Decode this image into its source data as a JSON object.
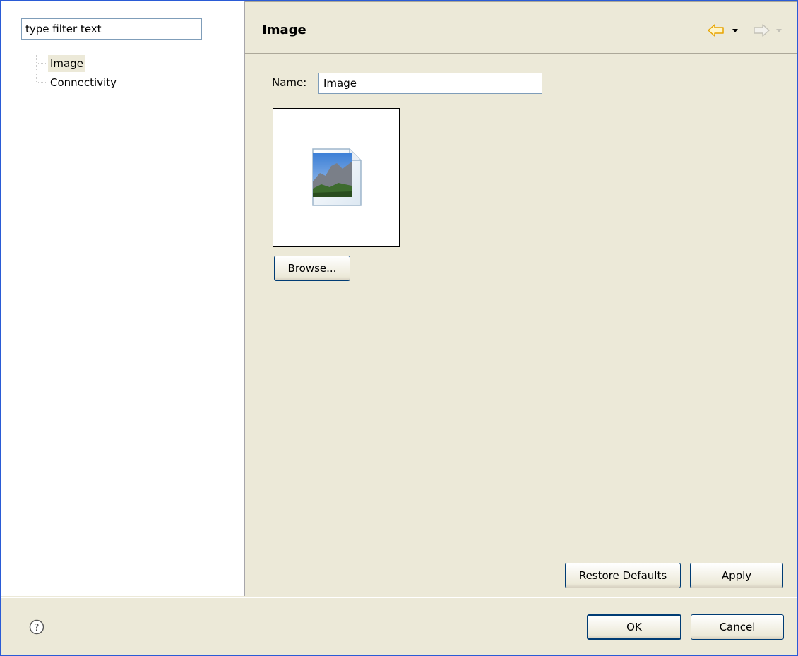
{
  "filter": {
    "placeholder": "type filter text",
    "value": "type filter text"
  },
  "tree": {
    "items": [
      {
        "label": "Image",
        "selected": true
      },
      {
        "label": "Connectivity",
        "selected": false
      }
    ]
  },
  "page": {
    "title": "Image",
    "name_label": "Name:",
    "name_value": "Image",
    "browse_label": "Browse...",
    "restore_defaults_prefix": "Restore ",
    "restore_defaults_mnemonic": "D",
    "restore_defaults_suffix": "efaults",
    "apply_mnemonic": "A",
    "apply_suffix": "pply"
  },
  "navigation": {
    "back_icon": "back-arrow-icon",
    "forward_icon": "forward-arrow-icon",
    "back_color": "#e8a400",
    "forward_color": "#c4c2b8"
  },
  "dialog": {
    "ok_label": "OK",
    "cancel_label": "Cancel",
    "help_icon": "help-icon"
  },
  "colors": {
    "frame_border": "#2a5bd6",
    "dialog_background": "#ece9d8",
    "button_border": "#003c74"
  }
}
